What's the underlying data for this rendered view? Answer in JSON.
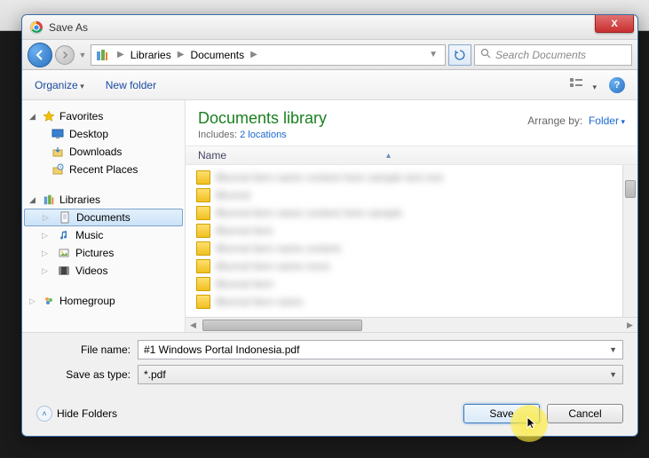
{
  "dialog": {
    "title": "Save As",
    "close": "X"
  },
  "breadcrumb": {
    "root_icon": "libraries",
    "items": [
      "Libraries",
      "Documents"
    ]
  },
  "search": {
    "placeholder": "Search Documents"
  },
  "toolbar": {
    "organize": "Organize",
    "new_folder": "New folder",
    "help": "?"
  },
  "sidebar": {
    "favorites": {
      "label": "Favorites",
      "items": [
        {
          "icon": "desktop",
          "label": "Desktop"
        },
        {
          "icon": "downloads",
          "label": "Downloads"
        },
        {
          "icon": "recent",
          "label": "Recent Places"
        }
      ]
    },
    "libraries": {
      "label": "Libraries",
      "items": [
        {
          "icon": "documents",
          "label": "Documents",
          "selected": true
        },
        {
          "icon": "music",
          "label": "Music"
        },
        {
          "icon": "pictures",
          "label": "Pictures"
        },
        {
          "icon": "videos",
          "label": "Videos"
        }
      ]
    },
    "homegroup": {
      "label": "Homegroup"
    }
  },
  "content": {
    "title": "Documents library",
    "subtitle_prefix": "Includes:",
    "subtitle_link": "2 locations",
    "arrange_label": "Arrange by:",
    "arrange_value": "Folder",
    "column_name": "Name"
  },
  "form": {
    "filename_label": "File name:",
    "filename_value": "#1 Windows Portal Indonesia.pdf",
    "type_label": "Save as type:",
    "type_value": "*.pdf"
  },
  "buttons": {
    "hide_folders": "Hide Folders",
    "save": "Save",
    "cancel": "Cancel"
  }
}
